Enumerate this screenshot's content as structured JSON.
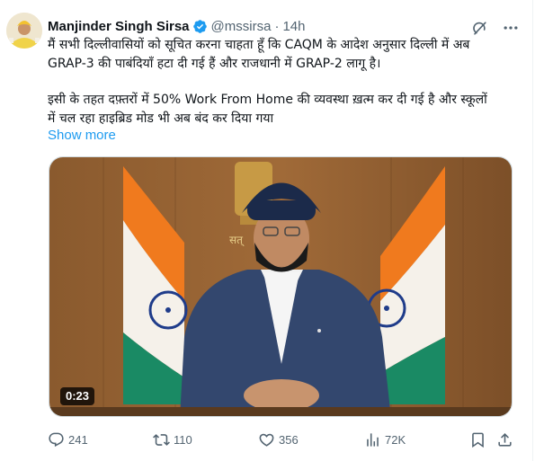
{
  "tweet": {
    "author_name": "Manjinder Singh Sirsa",
    "handle": "@mssirsa",
    "separator": "·",
    "time": "14h",
    "text_line_1": "मैं सभी दिल्लीवासियों को सूचित करना चाहता हूँ कि CAQM के आदेश अनुसार दिल्ली में अब",
    "text_line_2": "GRAP-3 की पाबंदियाँ हटा दी गई हैं और राजधानी में GRAP-2 लागू है।",
    "text_line_3": "इसी के तहत दफ़्तरों में 50% Work From Home की व्यवस्था ख़त्म कर दी गई है और स्कूलों",
    "text_line_4": "में चल रहा हाइब्रिड मोड भी अब बंद कर दिया गया",
    "show_more": "Show more",
    "video_duration": "0:23"
  },
  "icons": {
    "verified": "verified-badge-icon",
    "grok": "grok-icon",
    "more": "more-options-icon",
    "reply": "reply-icon",
    "retweet": "retweet-icon",
    "like": "like-icon",
    "views": "views-icon",
    "bookmark": "bookmark-icon",
    "share": "share-icon"
  },
  "stats": {
    "replies": "241",
    "retweets": "110",
    "likes": "356",
    "views": "72K"
  },
  "colors": {
    "text": "#0f1419",
    "secondary": "#536471",
    "link": "#1d9bf0",
    "verified": "#1d9bf0"
  }
}
